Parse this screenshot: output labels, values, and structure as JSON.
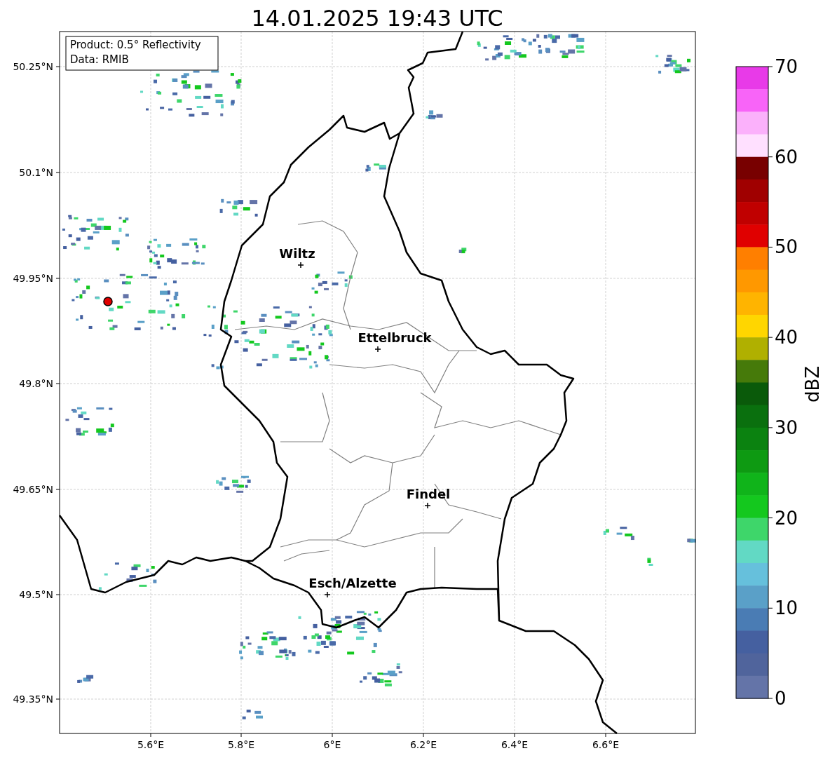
{
  "title": "14.01.2025 19:43 UTC",
  "info_box": [
    "Product: 0.5° Reflectivity",
    "Data: RMIB"
  ],
  "lat_ticks": [
    "50.25°N",
    "50.1°N",
    "49.95°N",
    "49.8°N",
    "49.65°N",
    "49.5°N",
    "49.35°N"
  ],
  "lon_ticks": [
    "5.6°E",
    "5.8°E",
    "6°E",
    "6.2°E",
    "6.4°E",
    "6.6°E"
  ],
  "cities": [
    {
      "name": "Wiltz"
    },
    {
      "name": "Ettelbruck"
    },
    {
      "name": "Findel"
    },
    {
      "name": "Esch/Alzette"
    }
  ],
  "colorbar": {
    "label": "dBZ",
    "ticks": [
      "70",
      "60",
      "50",
      "40",
      "30",
      "20",
      "10",
      "0"
    ],
    "bins": [
      {
        "color": "#e83ae8"
      },
      {
        "color": "#f864f8"
      },
      {
        "color": "#fbb1fb"
      },
      {
        "color": "#ffe0ff"
      },
      {
        "color": "#780000"
      },
      {
        "color": "#a00000"
      },
      {
        "color": "#c00000"
      },
      {
        "color": "#e00000"
      },
      {
        "color": "#ff7f00"
      },
      {
        "color": "#ff9800"
      },
      {
        "color": "#ffb400"
      },
      {
        "color": "#ffd600"
      },
      {
        "color": "#b0b000"
      },
      {
        "color": "#467a0a"
      },
      {
        "color": "#0a5a0a"
      },
      {
        "color": "#0a700e"
      },
      {
        "color": "#0b8210"
      },
      {
        "color": "#0e9a12"
      },
      {
        "color": "#10b41a"
      },
      {
        "color": "#14c81e"
      },
      {
        "color": "#3ed66a"
      },
      {
        "color": "#62d9c4"
      },
      {
        "color": "#66c0dc"
      },
      {
        "color": "#5aa0c8"
      },
      {
        "color": "#4a7cb4"
      },
      {
        "color": "#4560a0"
      },
      {
        "color": "#50649c"
      },
      {
        "color": "#6474a8"
      }
    ]
  }
}
